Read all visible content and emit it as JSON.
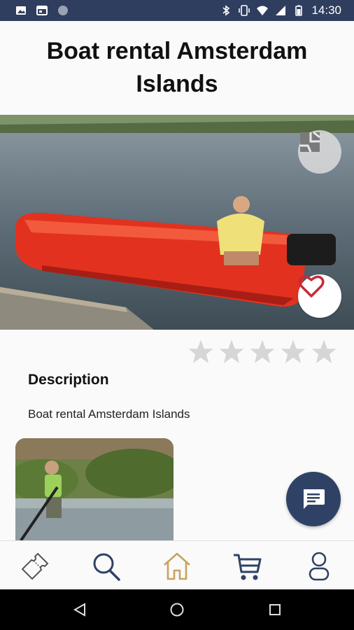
{
  "status_bar": {
    "time": "14:30",
    "icons": [
      "image-icon",
      "calendar-icon",
      "circle-icon",
      "bluetooth-icon",
      "vibrate-icon",
      "wifi-icon",
      "signal-icon",
      "battery-icon"
    ]
  },
  "header": {
    "title": "Boat rental Amsterdam Islands"
  },
  "hero": {
    "map_button_icon": "map-icon",
    "favorite_button_icon": "heart-icon"
  },
  "rating": {
    "stars_total": 5,
    "stars_filled": 0
  },
  "description": {
    "heading": "Description",
    "text": "Boat rental Amsterdam Islands"
  },
  "chat": {
    "icon": "chat-icon"
  },
  "tab_bar": {
    "tabs": [
      {
        "icon": "ticket-icon",
        "active": false
      },
      {
        "icon": "search-icon",
        "active": false
      },
      {
        "icon": "home-icon",
        "active": true
      },
      {
        "icon": "cart-icon",
        "active": false
      },
      {
        "icon": "user-icon",
        "active": false
      }
    ]
  },
  "colors": {
    "status_bar": "#2f3e5e",
    "accent": "#c9a25e",
    "icon": "#2f4266",
    "heart": "#c62a3a",
    "star_empty": "#d6d6d6"
  }
}
